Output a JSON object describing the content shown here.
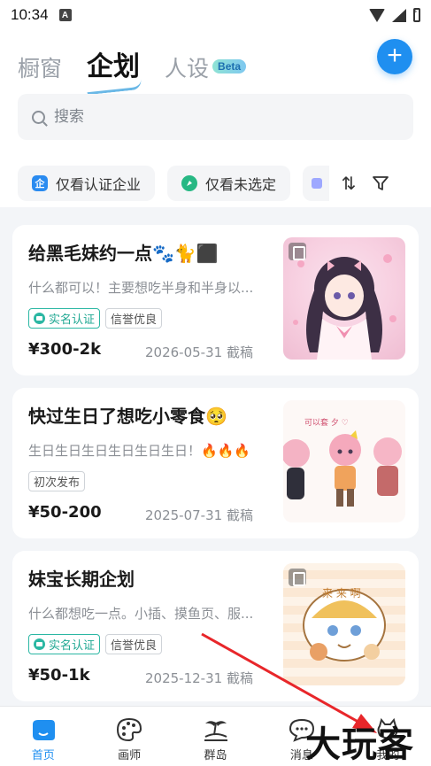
{
  "status_bar": {
    "time": "10:34",
    "notification_letter": "A"
  },
  "header": {
    "tabs": [
      {
        "label": "橱窗"
      },
      {
        "label": "企划"
      },
      {
        "label": "人设"
      }
    ],
    "beta_badge": "Beta",
    "add_button": "+"
  },
  "search": {
    "placeholder": "搜索"
  },
  "filters": {
    "chips": [
      {
        "label": "仅看认证企业",
        "icon": "企"
      },
      {
        "label": "仅看未选定"
      }
    ],
    "sort_icon": "⇅"
  },
  "cards": [
    {
      "title": "给黑毛妹约一点🐾🐈⬛",
      "desc": "什么都可以！主要想吃半身和半身以...",
      "tags": [
        "实名认证",
        "信誉优良"
      ],
      "price": "¥300-2k",
      "deadline": "2026-05-31 截稿"
    },
    {
      "title": "快过生日了想吃小零食🥺",
      "desc": "生日生日生日生日生日生日！🔥🔥🔥",
      "tags": [
        "初次发布"
      ],
      "price": "¥50-200",
      "deadline": "2025-07-31 截稿"
    },
    {
      "title": "妹宝长期企划",
      "desc": "什么都想吃一点。小插、摸鱼页、服...",
      "tags": [
        "实名认证",
        "信誉优良"
      ],
      "price": "¥50-1k",
      "deadline": "2025-12-31 截稿"
    }
  ],
  "bottom_nav": [
    {
      "label": "首页",
      "icon": "home-icon"
    },
    {
      "label": "画师",
      "icon": "palette-icon"
    },
    {
      "label": "群岛",
      "icon": "island-icon"
    },
    {
      "label": "消息",
      "icon": "chat-icon"
    },
    {
      "label": "我的",
      "icon": "profile-icon"
    }
  ],
  "watermark": "大玩客",
  "colors": {
    "accent": "#1f8ff0",
    "verified": "#2bb7a3"
  }
}
